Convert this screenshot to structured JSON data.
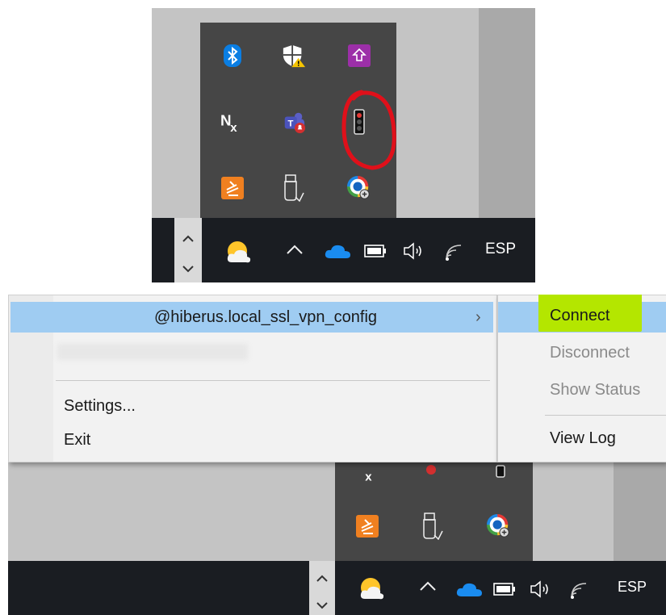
{
  "tray_overflow": {
    "icons": [
      "bluetooth-icon",
      "windows-security-warning-icon",
      "upload-app-icon",
      "nx-icon",
      "teams-icon",
      "vpn-traffic-light-icon",
      "sublime-text-icon",
      "usb-drive-icon",
      "update-tool-icon"
    ]
  },
  "taskbar": {
    "language": "ESP",
    "icons": [
      "weather-icon",
      "show-hidden-icons-chevron",
      "onedrive-icon",
      "battery-icon",
      "speaker-icon",
      "wifi-icon"
    ]
  },
  "context_menu": {
    "items": [
      {
        "label": "@hiberus.local_ssl_vpn_config",
        "arrow": "›",
        "state": "highlighted"
      },
      {
        "label": "",
        "state": "blurred"
      },
      {
        "label": "Settings...",
        "state": "normal"
      },
      {
        "label": "Exit",
        "state": "normal"
      }
    ]
  },
  "submenu": {
    "items": [
      {
        "label": "Connect",
        "state": "highlighted"
      },
      {
        "label": "Disconnect",
        "state": "disabled"
      },
      {
        "label": "Show Status",
        "state": "disabled"
      },
      {
        "label": "View Log",
        "state": "normal"
      }
    ]
  },
  "colors": {
    "menu_highlight": "#9fccf2",
    "connect_marker": "#b4e600",
    "annotation_circle": "#e0101a",
    "taskbar": "#1a1d22",
    "tray_overflow": "#464646"
  }
}
